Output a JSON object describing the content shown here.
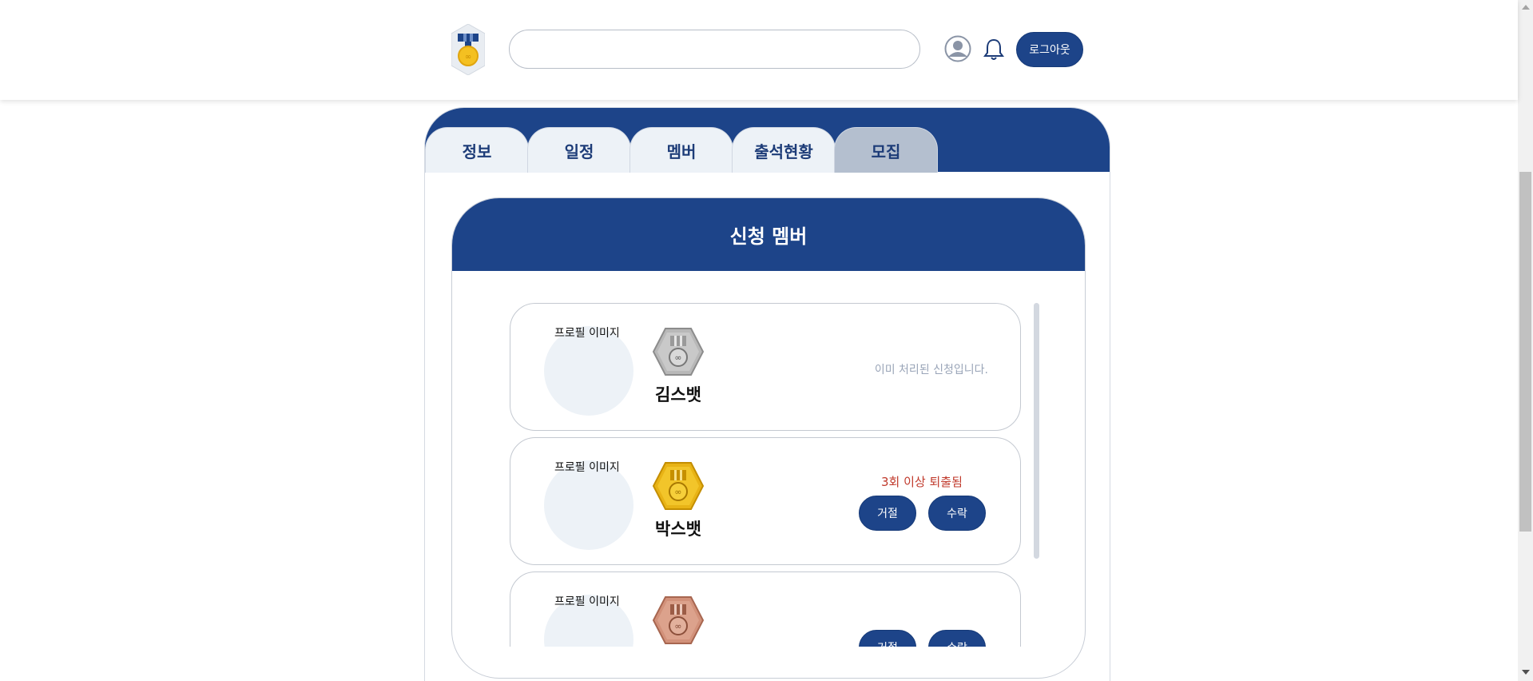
{
  "header": {
    "logout_label": "로그아웃",
    "search_value": ""
  },
  "tabs": [
    {
      "label": "정보"
    },
    {
      "label": "일정"
    },
    {
      "label": "멤버"
    },
    {
      "label": "출석현황"
    },
    {
      "label": "모집",
      "active": true
    }
  ],
  "applicants": {
    "title": "신청 멤버",
    "items": [
      {
        "avatar_alt": "프로필 이미지",
        "badge": "silver-medal-icon",
        "name": "김스뱃",
        "status": "이미 처리된 신청입니다."
      },
      {
        "avatar_alt": "프로필 이미지",
        "badge": "gold-medal-icon",
        "name": "박스뱃",
        "status": "3회 이상 퇴출됨",
        "reject_label": "거절",
        "accept_label": "수락"
      },
      {
        "avatar_alt": "프로필 이미지",
        "badge": "bronze-medal-icon",
        "reject_label": "거절",
        "accept_label": "수락"
      }
    ]
  },
  "colors": {
    "primary": "#1d4489",
    "tab_bg": "#edf2f7",
    "tab_active_bg": "#b4bfcf",
    "warning": "#c0392b",
    "muted": "#9aa5b8"
  }
}
